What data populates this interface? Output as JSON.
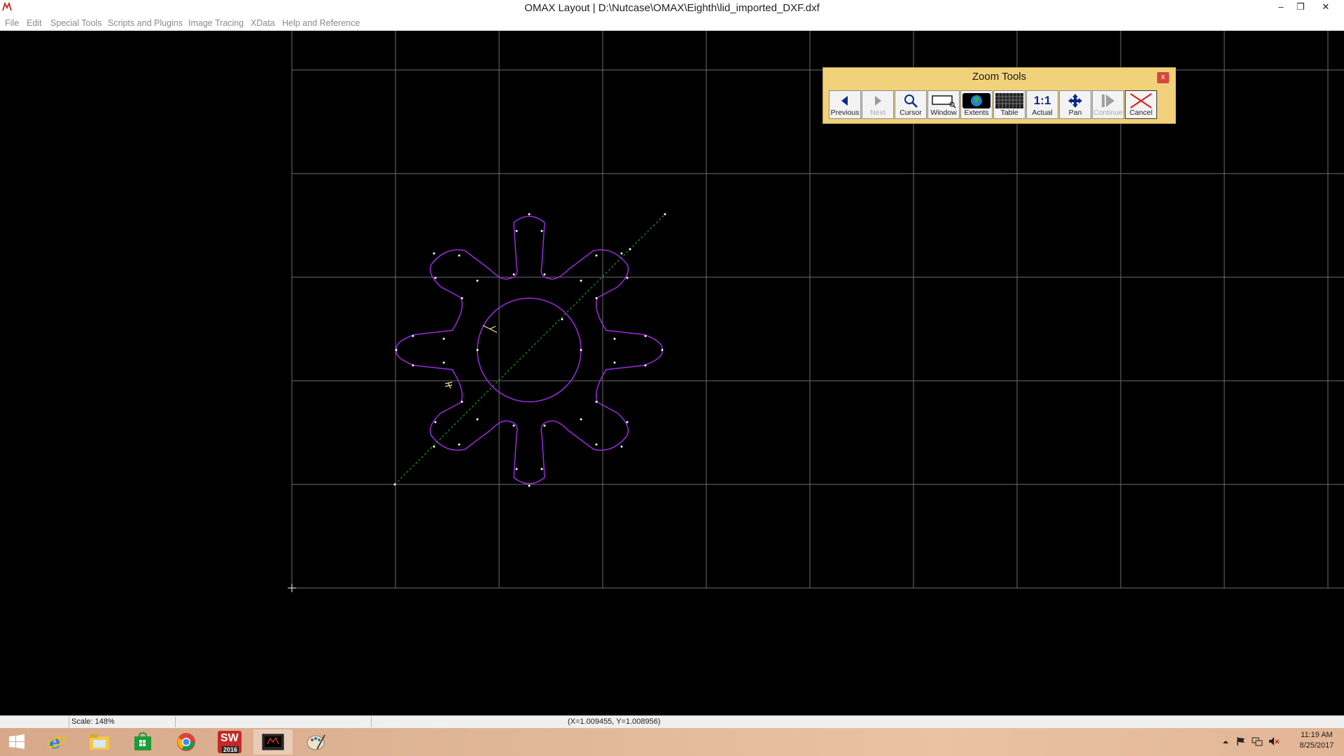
{
  "window": {
    "title": "OMAX Layout | D:\\Nutcase\\OMAX\\Eighth\\lid_imported_DXF.dxf",
    "minimize": "–",
    "restore": "❐",
    "close": "✕"
  },
  "menu": [
    "File",
    "Edit",
    "Special Tools",
    "Scripts and Plugins",
    "Image Tracing",
    "XData",
    "Help and Reference"
  ],
  "zoom_tools": {
    "title": "Zoom Tools",
    "close": "x",
    "buttons": [
      {
        "label": "Previous",
        "icon": "previous-icon",
        "enabled": true
      },
      {
        "label": "Next",
        "icon": "next-icon",
        "enabled": false
      },
      {
        "label": "Cursor",
        "icon": "magnifier-icon",
        "enabled": true
      },
      {
        "label": "Window",
        "icon": "window-zoom-icon",
        "enabled": true
      },
      {
        "label": "Extents",
        "icon": "globe-icon",
        "enabled": true
      },
      {
        "label": "Table",
        "icon": "table-icon",
        "enabled": true
      },
      {
        "label": "Actual",
        "icon": "actual-size-icon",
        "enabled": true
      },
      {
        "label": "Pan",
        "icon": "pan-icon",
        "enabled": true
      },
      {
        "label": "Continue",
        "icon": "continue-icon",
        "enabled": false
      },
      {
        "label": "Cancel",
        "icon": "cancel-icon",
        "enabled": true
      }
    ],
    "actual_glyph": "1:1"
  },
  "colors": {
    "grid": "#6e6e6e",
    "part_outline": "#9a2be0",
    "node_point": "#ffffff",
    "tool_path": "#1f9a1f",
    "panel": "#f1d27a"
  },
  "status": {
    "scale": "Scale: 148%",
    "coords": "(X=1.009455, Y=1.008956)"
  },
  "taskbar": {
    "apps": [
      "windows-start-icon",
      "internet-explorer-icon",
      "file-explorer-icon",
      "store-icon",
      "chrome-icon",
      "solidworks-icon",
      "omax-layout-icon",
      "paint-icon"
    ],
    "solidworks_badge": "2016",
    "time": "11:19 AM",
    "date": "8/25/2017"
  }
}
